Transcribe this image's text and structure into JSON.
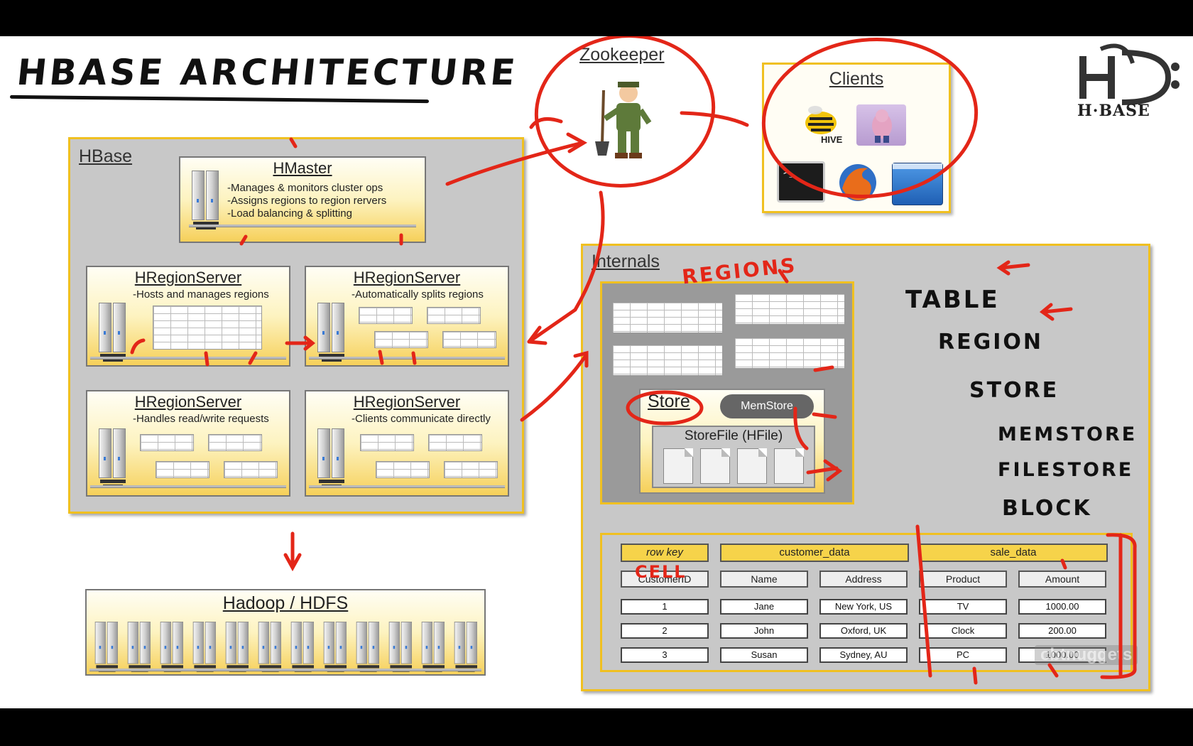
{
  "page_title": "HBASE ARCHITECTURE",
  "logo": {
    "text": "H·BASE",
    "icon": "hbase-logo-icon"
  },
  "hbase": {
    "title": "HBase",
    "hmaster": {
      "title": "HMaster",
      "lines": [
        "-Manages & monitors cluster ops",
        "-Assigns regions to region rervers",
        "-Load balancing & splitting"
      ]
    },
    "region_servers": [
      {
        "title": "HRegionServer",
        "desc": "-Hosts and manages regions"
      },
      {
        "title": "HRegionServer",
        "desc": "-Automatically splits regions"
      },
      {
        "title": "HRegionServer",
        "desc": "-Handles read/write requests"
      },
      {
        "title": "HRegionServer",
        "desc": "-Clients communicate directly"
      }
    ]
  },
  "hadoop": {
    "title": "Hadoop / HDFS"
  },
  "zookeeper": {
    "title": "Zookeeper",
    "icon": "zookeeper-mascot-icon"
  },
  "clients": {
    "title": "Clients",
    "icons": [
      "hive-bee-icon",
      "pig-icon",
      "terminal-icon",
      "firefox-icon",
      "window-icon"
    ],
    "hive_label": "HIVE"
  },
  "internals": {
    "title": "Internals",
    "store": {
      "title": "Store",
      "memstore": "MemStore",
      "storefile": "StoreFile (HFile)"
    },
    "table": {
      "headers": {
        "row_key": "row key",
        "cf1": "customer_data",
        "cf2": "sale_data"
      },
      "columns": [
        "CustomerID",
        "Name",
        "Address",
        "Product",
        "Amount"
      ],
      "rows": [
        [
          "1",
          "Jane",
          "New York, US",
          "TV",
          "1000.00"
        ],
        [
          "2",
          "John",
          "Oxford, UK",
          "Clock",
          "200.00"
        ],
        [
          "3",
          "Susan",
          "Sydney, AU",
          "PC",
          "1000.00"
        ]
      ]
    }
  },
  "annotations": {
    "regions": "REGIONS",
    "hierarchy": [
      "TABLE",
      "REGION",
      "STORE",
      "MEMSTORE",
      "FILESTORE",
      "BLOCK"
    ],
    "cell": "CELL"
  },
  "watermark": "cbtnuggets",
  "colors": {
    "panel_border": "#f0c020",
    "box_gradient_bottom": "#f6d05a",
    "annotation_red": "#e32618"
  }
}
